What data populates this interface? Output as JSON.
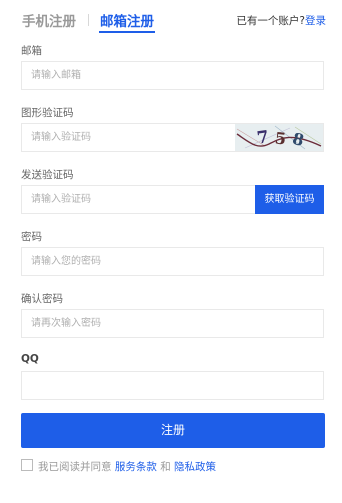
{
  "tabs": {
    "phone": "手机注册",
    "email": "邮箱注册"
  },
  "login": {
    "prompt": "已有一个账户?",
    "link": "登录"
  },
  "form": {
    "email": {
      "label": "邮箱",
      "placeholder": "请输入邮箱"
    },
    "captcha": {
      "label": "图形验证码",
      "placeholder": "请输入验证码",
      "image_text": "758"
    },
    "code": {
      "label": "发送验证码",
      "placeholder": "请输入验证码",
      "button": "获取验证码"
    },
    "password": {
      "label": "密码",
      "placeholder": "请输入您的密码"
    },
    "confirm": {
      "label": "确认密码",
      "placeholder": "请再次输入密码"
    },
    "qq": {
      "label": "QQ",
      "placeholder": ""
    }
  },
  "submit": "注册",
  "agreement": {
    "prefix": "我已阅读并同意",
    "terms": "服务条款",
    "and": "和",
    "privacy": "隐私政策"
  },
  "colors": {
    "accent": "#1e5ee8",
    "label": "#666666",
    "placeholder": "#b0b0b0"
  }
}
